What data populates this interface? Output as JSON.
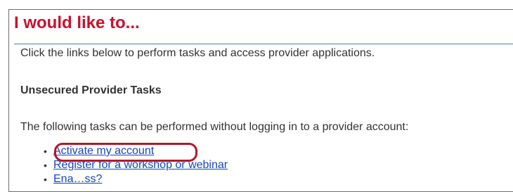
{
  "page": {
    "title": "I would like to...",
    "intro": "Click the links below to perform tasks and access provider applications."
  },
  "section": {
    "heading": "Unsecured Provider Tasks",
    "description": "The following tasks can be performed without logging in to a provider account:"
  },
  "tasks": [
    {
      "label": "Activate my account",
      "highlighted": true
    },
    {
      "label": "Register for a workshop or webinar",
      "highlighted": false
    },
    {
      "label": "Ena…ss?",
      "highlighted": false
    }
  ],
  "colors": {
    "title": "#c8102e",
    "link": "#1a44b8",
    "highlight": "#b2182b",
    "rule": "#4a7bb0"
  }
}
